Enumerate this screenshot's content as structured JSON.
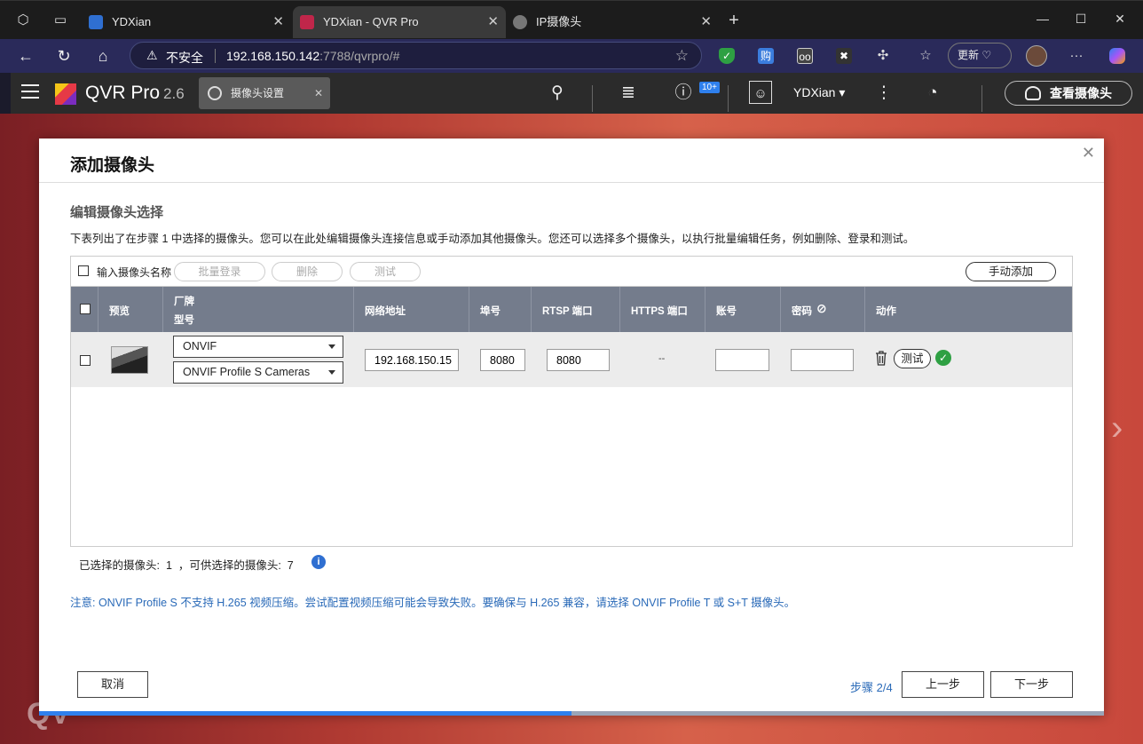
{
  "browser": {
    "tabs": [
      {
        "title": "YDXian"
      },
      {
        "title": "YDXian - QVR Pro"
      },
      {
        "title": "IP摄像头"
      }
    ],
    "omnibox": {
      "insecure_label": "不安全",
      "url_host": "192.168.150.142",
      "url_rest": ":7788/qvrpro/#"
    },
    "update_label": "更新"
  },
  "app": {
    "brand": "QVR Pro",
    "version": "2.6",
    "tab_label": "摄像头设置",
    "notification_badge": "10+",
    "username": "YDXian",
    "view_cameras_label": "查看摄像头"
  },
  "dialog": {
    "title": "添加摄像头",
    "section_title": "编辑摄像头选择",
    "description": "下表列出了在步骤 1 中选择的摄像头。您可以在此处编辑摄像头连接信息或手动添加其他摄像头。您还可以选择多个摄像头，以执行批量编辑任务，例如删除、登录和测试。",
    "toolbar": {
      "name_label": "输入摄像头名称",
      "batch_login": "批量登录",
      "delete": "删除",
      "test": "测试",
      "manual_add": "手动添加"
    },
    "columns": {
      "preview": "预览",
      "brand": "厂牌",
      "model": "型号",
      "address": "网络地址",
      "port": "埠号",
      "rtsp": "RTSP 端口",
      "https": "HTTPS 端口",
      "account": "账号",
      "password": "密码",
      "action": "动作"
    },
    "rows": [
      {
        "brand": "ONVIF",
        "model": "ONVIF Profile S Cameras",
        "address": "192.168.150.15",
        "port": "8080",
        "rtsp_port": "8080",
        "https_port": "--",
        "account": "",
        "password": "",
        "test_label": "测试"
      }
    ],
    "selected_label": "已选择的摄像头:",
    "selected_count": "1",
    "available_label": "，可供选择的摄像头:",
    "available_count": "7",
    "note": "注意: ONVIF Profile S 不支持 H.265 视频压缩。尝试配置视频压缩可能会导致失败。要确保与 H.265 兼容，请选择 ONVIF Profile T 或 S+T 摄像头。",
    "cancel": "取消",
    "step": "步骤 2/4",
    "prev": "上一步",
    "next": "下一步",
    "progress": 0.5
  },
  "colors": {
    "accent": "#2f80ed",
    "table_header": "#747c8c",
    "success": "#2ea043",
    "link": "#2a6ab8"
  }
}
